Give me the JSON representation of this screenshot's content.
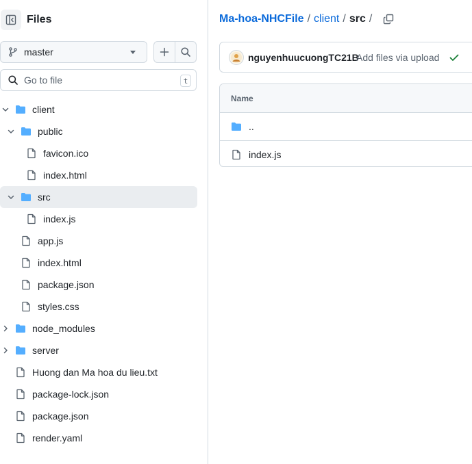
{
  "sidebar": {
    "title": "Files",
    "branch": "master",
    "search_placeholder": "Go to file",
    "search_shortcut": "t",
    "tree": [
      {
        "label": "client",
        "type": "folder",
        "depth": 0,
        "expanded": true
      },
      {
        "label": "public",
        "type": "folder",
        "depth": 1,
        "expanded": true
      },
      {
        "label": "favicon.ico",
        "type": "file",
        "depth": 2
      },
      {
        "label": "index.html",
        "type": "file",
        "depth": 2
      },
      {
        "label": "src",
        "type": "folder",
        "depth": 1,
        "expanded": true,
        "active": true
      },
      {
        "label": "index.js",
        "type": "file",
        "depth": 2
      },
      {
        "label": "app.js",
        "type": "file",
        "depth": 1
      },
      {
        "label": "index.html",
        "type": "file",
        "depth": 1
      },
      {
        "label": "package.json",
        "type": "file",
        "depth": 1
      },
      {
        "label": "styles.css",
        "type": "file",
        "depth": 1
      },
      {
        "label": "node_modules",
        "type": "folder",
        "depth": 0,
        "expanded": false
      },
      {
        "label": "server",
        "type": "folder",
        "depth": 0,
        "expanded": false
      },
      {
        "label": "Huong dan Ma hoa du lieu.txt",
        "type": "file",
        "depth": 0
      },
      {
        "label": "package-lock.json",
        "type": "file",
        "depth": 0
      },
      {
        "label": "package.json",
        "type": "file",
        "depth": 0
      },
      {
        "label": "render.yaml",
        "type": "file",
        "depth": 0
      }
    ]
  },
  "breadcrumb": {
    "repo": "Ma-hoa-NHCFile",
    "sep1": "/",
    "folder": "client",
    "sep2": "/",
    "current": "src",
    "sep3": "/"
  },
  "commit": {
    "author": "nguyenhuucuongTC21B",
    "message": "Add files via upload"
  },
  "table": {
    "header": "Name",
    "rows": [
      {
        "label": "..",
        "type": "folder"
      },
      {
        "label": "index.js",
        "type": "file"
      }
    ]
  },
  "colors": {
    "link": "#0969da",
    "folder": "#54aeff",
    "success": "#1a7f37",
    "muted": "#59636e"
  }
}
